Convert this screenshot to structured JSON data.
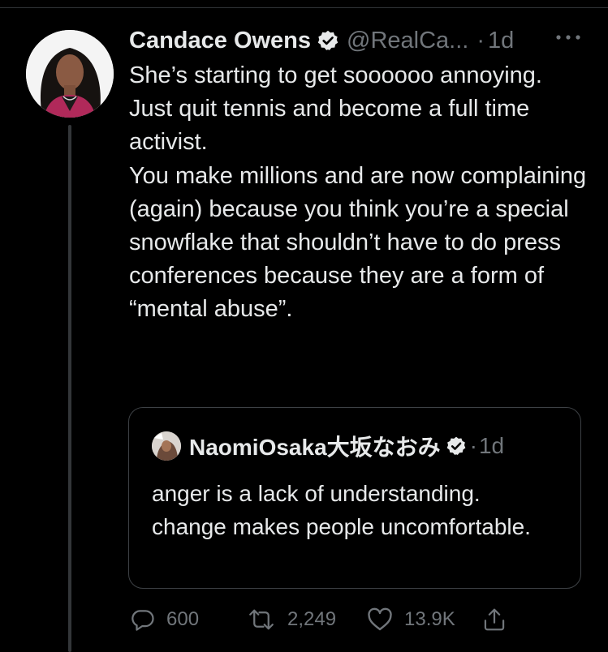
{
  "tweet": {
    "author": {
      "display_name": "Candace Owens",
      "handle": "@RealCa...",
      "verified": true
    },
    "separator": "·",
    "time": "1d",
    "text_lines": [
      "She’s starting to get soooooo annoying.",
      "Just quit tennis and become a full time activist.",
      "You make millions and are now complaining (again) because you think you’re a special snowflake that shouldn’t have to do press conferences because they are a form of “mental abuse”."
    ],
    "quote": {
      "author_name": "NaomiOsaka大坂なおみ",
      "verified": true,
      "separator": "·",
      "time": "1d",
      "text_lines": [
        "anger is a lack of understanding.",
        "change makes people uncomfortable."
      ]
    },
    "actions": {
      "reply": {
        "icon": "reply-icon",
        "count": "600"
      },
      "retweet": {
        "icon": "retweet-icon",
        "count": "2,249"
      },
      "like": {
        "icon": "heart-icon",
        "count": "13.9K"
      },
      "share": {
        "icon": "share-icon"
      }
    }
  },
  "colors": {
    "background": "#000000",
    "text_primary": "#e7e9ea",
    "text_secondary": "#71767b",
    "border": "#3d4145",
    "thread_line": "#333639"
  }
}
